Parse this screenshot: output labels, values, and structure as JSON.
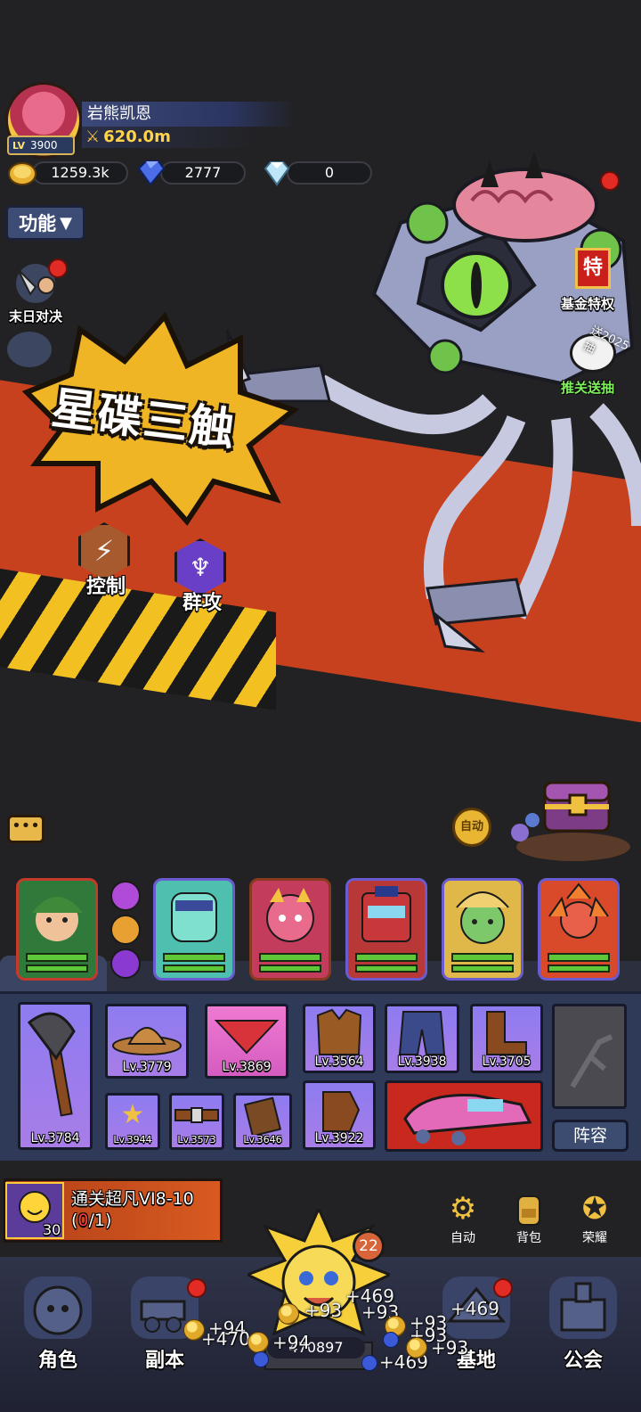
{
  "player": {
    "name": "岩熊凯恩",
    "level_prefix": "LV",
    "level": "3900",
    "power": "620.0m"
  },
  "currencies": [
    {
      "icon": "gold-coin-icon",
      "value": "1259.3k"
    },
    {
      "icon": "blue-gem-icon",
      "value": "2777"
    },
    {
      "icon": "diamond-icon",
      "value": "0"
    }
  ],
  "menu": {
    "function_label": "功能"
  },
  "left_side": [
    {
      "label": "末日对决",
      "icon": "axe-warrior-icon"
    }
  ],
  "right_side": [
    {
      "label": "基金特权",
      "badge_char": "特",
      "icon": "fund-privilege-icon"
    },
    {
      "label": "推关送抽",
      "badge_text": "送2025抽",
      "icon": "stage-gift-icon"
    }
  ],
  "boss": {
    "name": "星碟三触",
    "tags": [
      {
        "label": "控制",
        "icon": "lightning-icon",
        "color": "#a65a2e"
      },
      {
        "label": "群攻",
        "icon": "multi-blade-icon",
        "color": "#6a3fc8"
      }
    ]
  },
  "battle": {
    "auto_label": "自动"
  },
  "heroes": [
    {
      "name": "hero-elf-archer",
      "frame": "#c53a2a",
      "bg": "#2f7a3a"
    },
    {
      "name": "hero-ice-knight",
      "frame": "#6a5bd0",
      "bg": "#4fbfb0"
    },
    {
      "name": "hero-rock-bear",
      "frame": "#8a3a1e",
      "bg": "#c43c5c"
    },
    {
      "name": "hero-robot",
      "frame": "#6a5bd0",
      "bg": "#b83838"
    },
    {
      "name": "hero-plant-sage",
      "frame": "#6a5bd0",
      "bg": "#e0b84a"
    },
    {
      "name": "hero-fire-flower",
      "frame": "#6a5bd0",
      "bg": "#d84a2a"
    }
  ],
  "equipment": {
    "weapon": {
      "level": "Lv.3784"
    },
    "row1": [
      "Lv.3779",
      "Lv.3869",
      "Lv.3564",
      "Lv.3938",
      "Lv.3705"
    ],
    "row2_small": [
      "Lv.3944",
      "Lv.3573",
      "Lv.3646"
    ],
    "gloves": {
      "level": "Lv.3922"
    },
    "lineup_label": "阵容"
  },
  "quest": {
    "title": "通关超凡VI8-10",
    "progress_open": "(",
    "progress_current": "0",
    "progress_rest": "/1)",
    "count": "30"
  },
  "quick_buttons": [
    {
      "label": "自动",
      "icon": "gear-auto-icon"
    },
    {
      "label": "背包",
      "icon": "backpack-icon"
    },
    {
      "label": "荣耀",
      "icon": "honor-star-icon"
    }
  ],
  "nav": [
    {
      "label": "角色",
      "icon": "character-icon",
      "dot": false
    },
    {
      "label": "副本",
      "icon": "dungeon-cannon-icon",
      "dot": true
    },
    {
      "label": "基地",
      "icon": "base-icon",
      "dot": true
    },
    {
      "label": "公会",
      "icon": "guild-castle-icon",
      "dot": false
    }
  ],
  "center": {
    "badge_count": "22",
    "total_value": "470897",
    "floating": [
      "+469",
      "+93",
      "+93",
      "+94",
      "+470",
      "+94",
      "+93",
      "+469",
      "+93",
      "+469",
      "+93"
    ]
  }
}
